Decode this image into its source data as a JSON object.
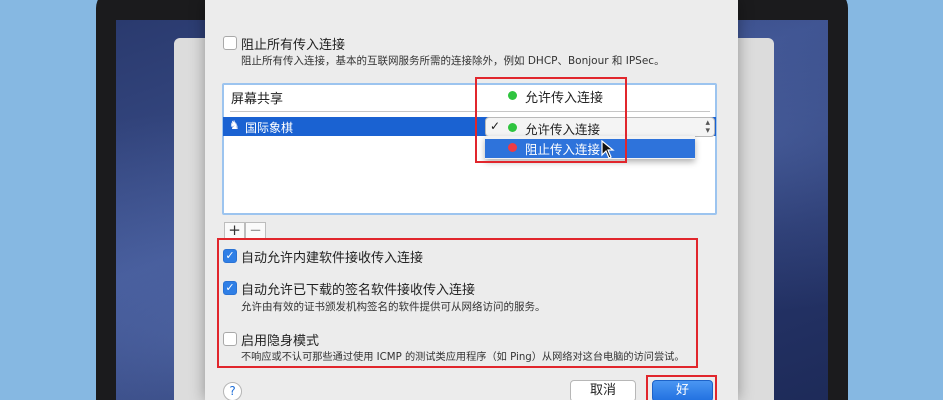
{
  "firewall_options": {
    "block_all": {
      "label": "阻止所有传入连接",
      "description": "阻止所有传入连接，基本的互联网服务所需的连接除外，例如 DHCP、Bonjour 和 IPSec。",
      "checked": false
    },
    "app_list": {
      "rows": [
        {
          "name": "屏幕共享",
          "status": "允许传入连接",
          "status_color": "#2fc43f"
        },
        {
          "name": "国际象棋",
          "status": "允许传入连接",
          "status_color": "#2fc43f",
          "selected": true
        }
      ],
      "dropdown": {
        "check_mark": "✓",
        "options": [
          {
            "label": "允许传入连接",
            "color": "#2fc43f"
          },
          {
            "label": "阻止传入连接",
            "color": "#ee3b45"
          }
        ]
      },
      "add_label": "+",
      "remove_label": "−"
    },
    "auto_allow_builtin": {
      "label": "自动允许内建软件接收传入连接",
      "checked": true
    },
    "auto_allow_signed": {
      "label": "自动允许已下载的签名软件接收传入连接",
      "description": "允许由有效的证书颁发机构签名的软件提供可从网络访问的服务。",
      "checked": true
    },
    "stealth_mode": {
      "label": "启用隐身模式",
      "description": "不响应或不认可那些通过使用 ICMP 的测试类应用程序（如 Ping）从网络对这台电脑的访问尝试。",
      "checked": false
    }
  },
  "footer": {
    "help_label": "?",
    "cancel_label": "取消",
    "ok_label": "好"
  },
  "colors": {
    "accent": "#1a62d2",
    "annotation_red": "#e1262c",
    "background": "#86b8e2"
  }
}
